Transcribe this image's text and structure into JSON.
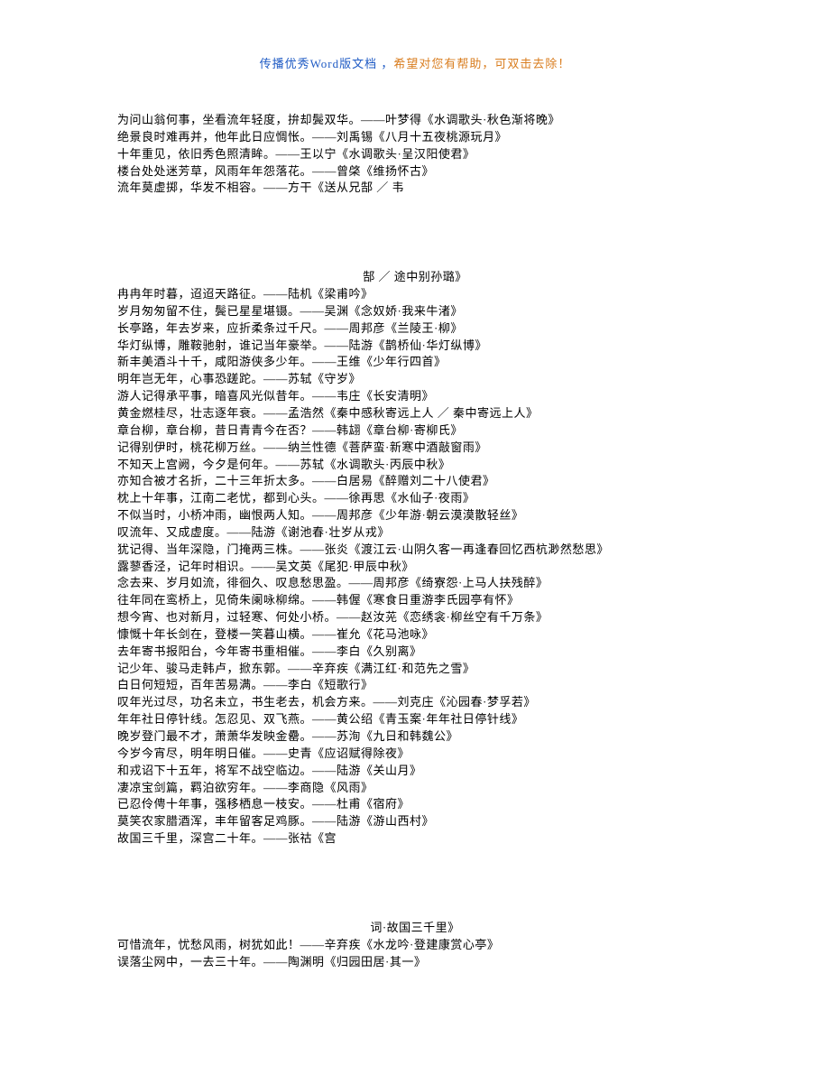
{
  "header": {
    "blue1": "传播优秀Word版文档 ，",
    "orange": "希望对您有帮助，可双击去除！"
  },
  "lines": [
    "为问山翁何事，坐看流年轻度，拚却鬓双华。——叶梦得《水调歌头·秋色渐将晚》",
    "绝景良时难再并，他年此日应惆怅。——刘禹锡《八月十五夜桃源玩月》",
    "十年重见，依旧秀色照清眸。——王以宁《水调歌头·呈汉阳使君》",
    "楼台处处迷芳草，风雨年年怨落花。——曾棨《维扬怀古》",
    "流年莫虚掷，华发不相容。——方干《送从兄郜 ／ 韦"
  ],
  "inset1": "郜 ／ 途中别孙璐》",
  "lines2": [
    "冉冉年时暮，迢迢天路征。——陆机《梁甫吟》",
    "岁月匆匆留不住，鬓已星星堪镊。——吴渊《念奴娇·我来牛渚》",
    "长亭路，年去岁来，应折柔条过千尺。——周邦彦《兰陵王·柳》",
    "华灯纵博，雕鞍驰射，谁记当年豪举。——陆游《鹊桥仙·华灯纵博》",
    "新丰美酒斗十千，咸阳游侠多少年。——王维《少年行四首》",
    "明年岂无年，心事恐蹉跎。——苏轼《守岁》",
    "游人记得承平事，暗喜风光似昔年。——韦庄《长安清明》",
    "黄金燃桂尽，壮志逐年衰。——孟浩然《秦中感秋寄远上人 ／ 秦中寄远上人》",
    "章台柳，章台柳，昔日青青今在否？——韩翃《章台柳·寄柳氏》",
    "记得别伊时，桃花柳万丝。——纳兰性德《菩萨蛮·新寒中酒敲窗雨》",
    "不知天上宫阙，今夕是何年。——苏轼《水调歌头·丙辰中秋》",
    "亦知合被才名折，二十三年折太多。——白居易《醉赠刘二十八使君》",
    "枕上十年事，江南二老忧，都到心头。——徐再思《水仙子·夜雨》",
    "不似当时，小桥冲雨，幽恨两人知。——周邦彦《少年游·朝云漠漠散轻丝》",
    "叹流年、又成虚度。——陆游《谢池春·壮岁从戎》",
    "犹记得、当年深隐，门掩两三株。——张炎《渡江云·山阴久客一再逢春回忆西杭渺然愁思》",
    "露蓼香泾，记年时相识。——吴文英《尾犯·甲辰中秋》",
    "念去来、岁月如流，徘徊久、叹息愁思盈。——周邦彦《绮寮怨·上马人扶残醉》",
    "往年同在鸾桥上，见倚朱阑咏柳绵。——韩偓《寒食日重游李氏园亭有怀》",
    "想今宵、也对新月，过轻寒、何处小桥。——赵汝茪《恋绣衾·柳丝空有千万条》",
    "慷慨十年长剑在，登楼一笑暮山横。——崔允《花马池咏》",
    "去年寄书报阳台，今年寄书重相催。——李白《久别离》",
    "记少年、骏马走韩卢，掀东郭。——辛弃疾《满江红·和范先之雪》",
    "白日何短短，百年苦易满。——李白《短歌行》",
    "叹年光过尽，功名未立，书生老去，机会方来。——刘克庄《沁园春·梦孚若》",
    "年年社日停针线。怎忍见、双飞燕。——黄公绍《青玉案·年年社日停针线》",
    "晚岁登门最不才，萧萧华发映金罍。——苏洵《九日和韩魏公》",
    "今岁今宵尽，明年明日催。——史青《应诏赋得除夜》",
    "和戎诏下十五年，将军不战空临边。——陆游《关山月》",
    "凄凉宝剑篇，羁泊欲穷年。——李商隐《风雨》",
    "已忍伶俜十年事，强移栖息一枝安。——杜甫《宿府》",
    "莫笑农家腊酒浑，丰年留客足鸡豚。——陆游《游山西村》",
    "故国三千里，深宫二十年。——张祜《宫"
  ],
  "inset2": "词·故国三千里》",
  "lines3": [
    "可惜流年，忧愁风雨，树犹如此！——辛弃疾《水龙吟·登建康赏心亭》",
    "误落尘网中，一去三十年。——陶渊明《归园田居·其一》"
  ]
}
